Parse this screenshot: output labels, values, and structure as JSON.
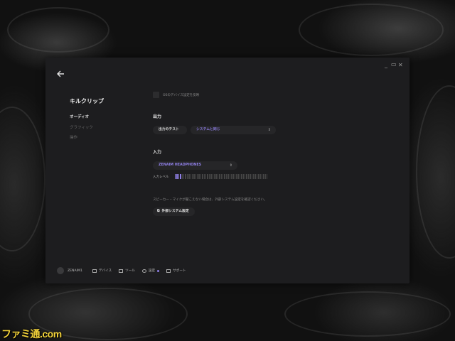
{
  "app": {
    "title": "キルクリップ"
  },
  "nav": {
    "items": [
      {
        "label": "オーディオ",
        "active": true
      },
      {
        "label": "グラフィック",
        "active": false
      },
      {
        "label": "操作",
        "active": false
      }
    ]
  },
  "audio": {
    "os_checkbox_label": "OSのデバイス設定を反映",
    "output": {
      "heading": "出力",
      "test_button": "出力のテスト",
      "device_select": "システムと同じ"
    },
    "input": {
      "heading": "入力",
      "device_select": "ZENAIM HEADPHONES",
      "level_label": "入力レベル",
      "level_fraction": 0.07
    },
    "note": "スピーカー・マイクが聞こえない場合は、外部システム設定を確認ください。",
    "external_button": "外部システム設定"
  },
  "footer": {
    "username": "ZENAIM1",
    "links": [
      {
        "label": "デバイス",
        "icon": "device-icon"
      },
      {
        "label": "ツール",
        "icon": "tool-icon"
      },
      {
        "label": "設定",
        "icon": "gear-icon"
      },
      {
        "label": "サポート",
        "icon": "chat-icon"
      }
    ]
  },
  "watermark": "ファミ通.com",
  "colors": {
    "accent": "#8f7fe6",
    "window_bg": "#1d1d1f",
    "desktop_bg": "#111111"
  }
}
